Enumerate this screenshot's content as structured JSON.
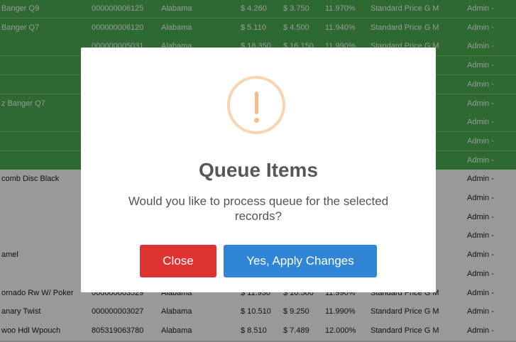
{
  "table": {
    "rows": [
      {
        "name": "Banger Q9",
        "upc": "000000006125",
        "state": "Alabama",
        "price": "$ 4.260",
        "cost": "$ 3.750",
        "margin": "11.970%",
        "rule": "Standard Price G M",
        "user": "Admin -",
        "selected": true
      },
      {
        "name": "Banger Q7",
        "upc": "000000006120",
        "state": "Alabama",
        "price": "$ 5.110",
        "cost": "$ 4.500",
        "margin": "11.940%",
        "rule": "Standard Price G M",
        "user": "Admin -",
        "selected": true
      },
      {
        "name": "",
        "upc": "000000005031",
        "state": "Alabama",
        "price": "$ 18.350",
        "cost": "$ 16.150",
        "margin": "11.990%",
        "rule": "Standard Price G M",
        "user": "Admin -",
        "selected": true
      },
      {
        "name": "",
        "upc": "",
        "state": "",
        "price": "",
        "cost": "",
        "margin": "",
        "rule": "",
        "user": "Admin -",
        "selected": true
      },
      {
        "name": "",
        "upc": "",
        "state": "",
        "price": "",
        "cost": "",
        "margin": "",
        "rule": "",
        "user": "Admin -",
        "selected": true
      },
      {
        "name": "z Banger Q7",
        "upc": "",
        "state": "",
        "price": "",
        "cost": "",
        "margin": "",
        "rule": "",
        "user": "Admin -",
        "selected": true
      },
      {
        "name": "",
        "upc": "",
        "state": "",
        "price": "",
        "cost": "",
        "margin": "",
        "rule": "",
        "user": "Admin -",
        "selected": true
      },
      {
        "name": "",
        "upc": "",
        "state": "",
        "price": "",
        "cost": "",
        "margin": "",
        "rule": "",
        "user": "Admin -",
        "selected": true
      },
      {
        "name": "",
        "upc": "",
        "state": "",
        "price": "",
        "cost": "",
        "margin": "",
        "rule": "",
        "user": "Admin -",
        "selected": true
      },
      {
        "name": "comb Disc Black",
        "upc": "",
        "state": "",
        "price": "",
        "cost": "",
        "margin": "",
        "rule": "",
        "user": "Admin -",
        "selected": false
      },
      {
        "name": "",
        "upc": "",
        "state": "",
        "price": "",
        "cost": "",
        "margin": "",
        "rule": "",
        "user": "Admin -",
        "selected": false
      },
      {
        "name": "",
        "upc": "",
        "state": "",
        "price": "",
        "cost": "",
        "margin": "",
        "rule": "",
        "user": "Admin -",
        "selected": false
      },
      {
        "name": "",
        "upc": "",
        "state": "",
        "price": "",
        "cost": "",
        "margin": "",
        "rule": "",
        "user": "Admin -",
        "selected": false
      },
      {
        "name": "amel",
        "upc": "",
        "state": "",
        "price": "",
        "cost": "",
        "margin": "",
        "rule": "",
        "user": "Admin -",
        "selected": false
      },
      {
        "name": "",
        "upc": "",
        "state": "",
        "price": "",
        "cost": "",
        "margin": "",
        "rule": "",
        "user": "Admin -",
        "selected": false
      },
      {
        "name": "ornado Rw W/ Poker",
        "upc": "000000003529",
        "state": "Alabama",
        "price": "$ 11.930",
        "cost": "$ 10.500",
        "margin": "11.990%",
        "rule": "Standard Price G M",
        "user": "Admin -",
        "selected": false
      },
      {
        "name": "anary Twist",
        "upc": "000000003027",
        "state": "Alabama",
        "price": "$ 10.510",
        "cost": "$ 9.250",
        "margin": "11.990%",
        "rule": "Standard Price G M",
        "user": "Admin -",
        "selected": false
      },
      {
        "name": "woo Hdl Wpouch",
        "upc": "805319063780",
        "state": "Alabama",
        "price": "$ 8.510",
        "cost": "$ 7.489",
        "margin": "12.000%",
        "rule": "Standard Price G M",
        "user": "Admin -",
        "selected": false
      }
    ]
  },
  "modal": {
    "icon": "warning-exclamation-icon",
    "title": "Queue Items",
    "text": "Would you like to process queue for the selected records?",
    "close_label": "Close",
    "confirm_label": "Yes, Apply Changes"
  },
  "colors": {
    "selected_row": "#4caf50",
    "close_button": "#dd3333",
    "confirm_button": "#3085d6",
    "warning": "#f8bb86"
  }
}
